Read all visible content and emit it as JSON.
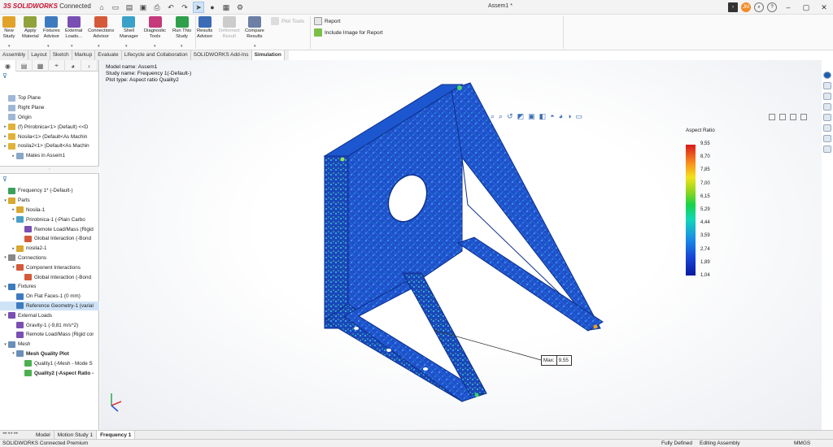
{
  "app": {
    "logo_prefix": "3S",
    "logo_brand": "SOLIDWORKS",
    "logo_suffix": "Connected",
    "document_title": "Assem1 *"
  },
  "ribbon": {
    "buttons": [
      {
        "label": "New\nStudy",
        "color": "#e1a22c"
      },
      {
        "label": "Apply\nMaterial",
        "color": "#8fa23b"
      },
      {
        "label": "Fixtures\nAdvisor",
        "color": "#3d7bbf"
      },
      {
        "label": "External\nLoads...",
        "color": "#7a4fb3"
      },
      {
        "label": "Connections\nAdvisor",
        "color": "#d45a3a"
      },
      {
        "label": "Shell\nManager",
        "color": "#3aa2c8"
      },
      {
        "label": "Diagnostic\nTools",
        "color": "#c43a7a"
      },
      {
        "label": "Run This\nStudy",
        "color": "#2f9f4b"
      },
      {
        "label": "Results\nAdvisor",
        "color": "#3b6cb5"
      },
      {
        "label": "Deformed\nResult",
        "color": "#cccccc",
        "disabled": true
      },
      {
        "label": "Compare\nResults",
        "color": "#6c7fa6"
      }
    ],
    "plot_tools": "Plot Tools",
    "report": "Report",
    "include_image": "Include Image for Report"
  },
  "tabs": [
    "Assembly",
    "Layout",
    "Sketch",
    "Markup",
    "Evaluate",
    "Lifecycle and Collaboration",
    "SOLIDWORKS Add-Ins",
    "Simulation"
  ],
  "active_tab": "Simulation",
  "feature_tree": [
    {
      "label": "Top Plane",
      "color": "#9fb7d6"
    },
    {
      "label": "Right Plane",
      "color": "#9fb7d6"
    },
    {
      "label": "Origin",
      "color": "#9fb7d6"
    },
    {
      "label": "(f) Prirobnica<1> (Default) <<D",
      "color": "#e0b23a",
      "tw": "▸"
    },
    {
      "label": "Nosila<1> (Default<As Machin",
      "color": "#e0b23a",
      "tw": "▸"
    },
    {
      "label": "nosila2<1> (Default<As Machin",
      "color": "#e0b23a",
      "tw": "▸"
    },
    {
      "label": "Mates in Assem1",
      "color": "#8aa7c7",
      "tw": "▸",
      "indent": 1
    }
  ],
  "sim_tree": [
    {
      "label": "Frequency 1* (-Default-)",
      "color": "#3aa05a",
      "indent": 0
    },
    {
      "label": "Parts",
      "color": "#d8a830",
      "tw": "▾",
      "indent": 0
    },
    {
      "label": "Nosila-1",
      "color": "#d8a830",
      "tw": "▸",
      "indent": 1
    },
    {
      "label": "Prirobnica-1 (-Plain Carbo",
      "color": "#4aa0c8",
      "tw": "▾",
      "indent": 1
    },
    {
      "label": "Remote Load/Mass (Rigid",
      "color": "#7a4fb3",
      "indent": 2
    },
    {
      "label": "Global Interaction (-Bond",
      "color": "#d45a3a",
      "indent": 2
    },
    {
      "label": "nosila2-1",
      "color": "#d8a830",
      "tw": "▸",
      "indent": 1
    },
    {
      "label": "Connections",
      "color": "#888888",
      "tw": "▾",
      "indent": 0
    },
    {
      "label": "Component Interactions",
      "color": "#d45a3a",
      "tw": "▾",
      "indent": 1
    },
    {
      "label": "Global Interaction (-Bond",
      "color": "#d45a3a",
      "indent": 2
    },
    {
      "label": "Fixtures",
      "color": "#3d7bbf",
      "tw": "▾",
      "indent": 0
    },
    {
      "label": "On Flat Faces-1 (0 mm)",
      "color": "#3d7bbf",
      "indent": 1
    },
    {
      "label": "Reference Geometry-1 (varial",
      "color": "#3d7bbf",
      "indent": 1,
      "selected": true
    },
    {
      "label": "External Loads",
      "color": "#7a4fb3",
      "tw": "▾",
      "indent": 0
    },
    {
      "label": "Gravity-1 (-9,81 m/s^2)",
      "color": "#7a4fb3",
      "indent": 1
    },
    {
      "label": "Remote Load/Mass (Rigid cor",
      "color": "#7a4fb3",
      "indent": 1
    },
    {
      "label": "Mesh",
      "color": "#6a8fb8",
      "tw": "▾",
      "indent": 0
    },
    {
      "label": "Mesh Quality Plot",
      "color": "#6a8fb8",
      "tw": "▾",
      "indent": 1,
      "bold": true
    },
    {
      "label": "Quality1 (-Mesh - Mode S",
      "color": "#4caf50",
      "indent": 2
    },
    {
      "label": "Quality2 (-Aspect Ratio -",
      "color": "#4caf50",
      "indent": 2,
      "bold": true
    }
  ],
  "study_info": {
    "model_name": "Model name: Assem1",
    "study_name": "Study name: Frequency 1(-Default-)",
    "plot_type": "Plot type: Aspect ratio Quality2"
  },
  "legend": {
    "title": "Aspect Ratio",
    "values": [
      "9,55",
      "8,70",
      "7,85",
      "7,00",
      "6,15",
      "5,29",
      "4,44",
      "3,59",
      "2,74",
      "1,89",
      "1,04"
    ]
  },
  "annotation": {
    "label": "Max:",
    "value": "9,55"
  },
  "bottom_tabs": [
    "Model",
    "Motion Study 1",
    "Frequency 1"
  ],
  "active_bottom_tab": "Frequency 1",
  "status": {
    "product": "SOLIDWORKS Connected Premium",
    "defined": "Fully Defined",
    "mode": "Editing Assembly",
    "units": "MMGS"
  }
}
